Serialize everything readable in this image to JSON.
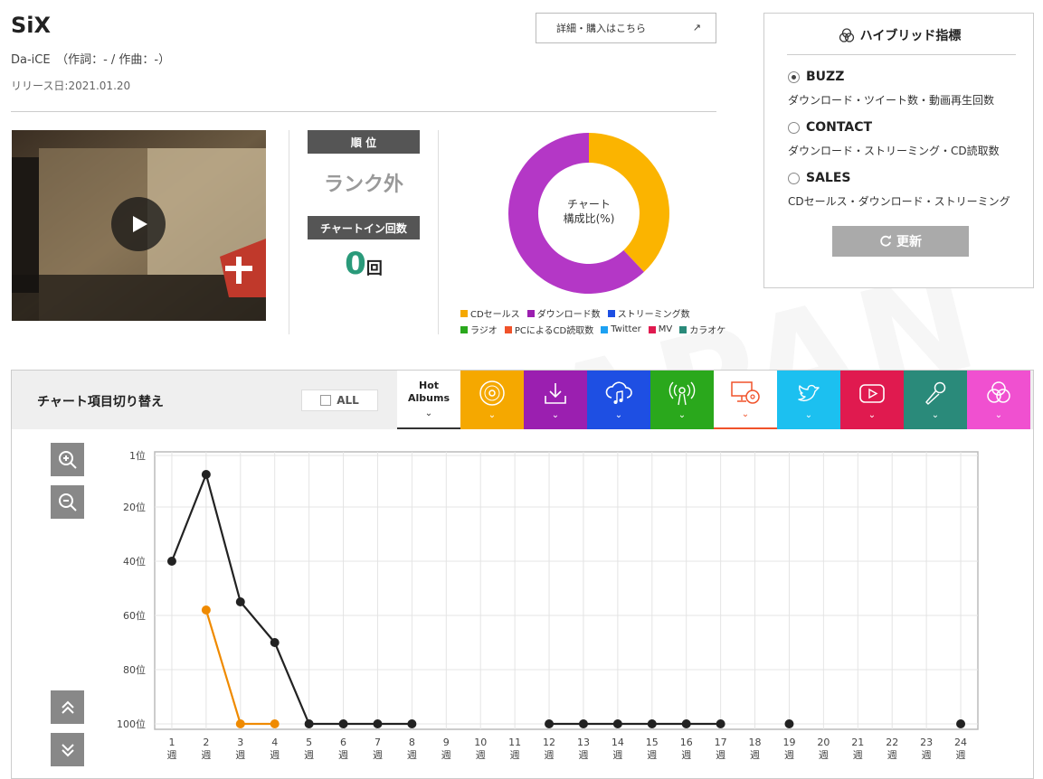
{
  "song": {
    "title": "SiX",
    "artist_line": "Da-iCE　（作詞：- / 作曲：-）",
    "release": "リリース日:2021.01.20",
    "detail_button": "詳細・購入はこちら",
    "detail_arrow": "↗"
  },
  "stats": {
    "rank_label": "順 位",
    "rank_value": "ランク外",
    "chartin_label": "チャートイン回数",
    "chartin_value": "0",
    "chartin_unit": "回"
  },
  "donut": {
    "center_line1": "チャート",
    "center_line2": "構成比(%)",
    "slices": [
      {
        "name": "CDセールス",
        "value": 38,
        "color": "#fbb400"
      },
      {
        "name": "ダウンロード数",
        "value": 62,
        "color": "#b437c6"
      }
    ],
    "legend_row1": [
      {
        "name": "CDセールス",
        "color": "#f5a800"
      },
      {
        "name": "ダウンロード数",
        "color": "#9b1fb0"
      },
      {
        "name": "ストリーミング数",
        "color": "#1e4fe3"
      }
    ],
    "legend_row2": [
      {
        "name": "ラジオ",
        "color": "#2aa81c"
      },
      {
        "name": "PCによるCD読取数",
        "color": "#f0522a"
      },
      {
        "name": "Twitter",
        "color": "#1da1f2"
      },
      {
        "name": "MV",
        "color": "#e01a4f"
      },
      {
        "name": "カラオケ",
        "color": "#2a8a7a"
      }
    ]
  },
  "hybrid": {
    "title": "ハイブリッド指標",
    "options": [
      {
        "label": "BUZZ",
        "desc": "ダウンロード・ツイート数・動画再生回数",
        "selected": true
      },
      {
        "label": "CONTACT",
        "desc": "ダウンロード・ストリーミング・CD読取数",
        "selected": false
      },
      {
        "label": "SALES",
        "desc": "CDセールス・ダウンロード・ストリーミング",
        "selected": false
      }
    ],
    "update_button": "更新"
  },
  "panel": {
    "switch_label": "チャート項目切り替え",
    "all_label": "ALL",
    "hot_line1": "Hot",
    "hot_line2": "Albums",
    "tabs": [
      {
        "icon": "cd-icon",
        "color": "#f5a800"
      },
      {
        "icon": "download-icon",
        "color": "#9b1fb0"
      },
      {
        "icon": "streaming-cloud-icon",
        "color": "#1e4fe3"
      },
      {
        "icon": "radio-icon",
        "color": "#2aa81c"
      },
      {
        "icon": "pc-cd-icon",
        "color": "#ffffff"
      },
      {
        "icon": "twitter-icon",
        "color": "#1cc0f0"
      },
      {
        "icon": "youtube-icon",
        "color": "#e01a4f"
      },
      {
        "icon": "karaoke-mic-icon",
        "color": "#2a8a7a"
      },
      {
        "icon": "hybrid-icon",
        "color": "#f050d0"
      }
    ]
  },
  "chart_data": {
    "type": "line",
    "y_tick_labels": [
      "1位",
      "20位",
      "40位",
      "60位",
      "80位",
      "100位"
    ],
    "y_ticks": [
      1,
      20,
      40,
      60,
      80,
      100
    ],
    "ylim": [
      1,
      100
    ],
    "y_inverted": true,
    "x_tick_labels": [
      "1週",
      "2週",
      "3週",
      "4週",
      "5週",
      "6週",
      "7週",
      "8週",
      "9週",
      "10週",
      "11週",
      "12週",
      "13週",
      "14週",
      "15週",
      "16週",
      "17週",
      "18週",
      "19週",
      "20週",
      "21週",
      "22週",
      "23週",
      "24週"
    ],
    "x": [
      1,
      2,
      3,
      4,
      5,
      6,
      7,
      8,
      9,
      10,
      11,
      12,
      13,
      14,
      15,
      16,
      17,
      18,
      19,
      20,
      21,
      22,
      23,
      24
    ],
    "grid": true,
    "series": [
      {
        "color": "#222222",
        "values": [
          40,
          8,
          55,
          70,
          100,
          100,
          100,
          100,
          null,
          null,
          null,
          100,
          100,
          100,
          100,
          100,
          100,
          null,
          100,
          null,
          null,
          null,
          null,
          100
        ]
      },
      {
        "color": "#ef8a00",
        "values": [
          null,
          58,
          100,
          100,
          null,
          null,
          null,
          null,
          null,
          null,
          null,
          null,
          null,
          null,
          null,
          null,
          null,
          null,
          null,
          null,
          null,
          null,
          null,
          null
        ]
      }
    ]
  }
}
